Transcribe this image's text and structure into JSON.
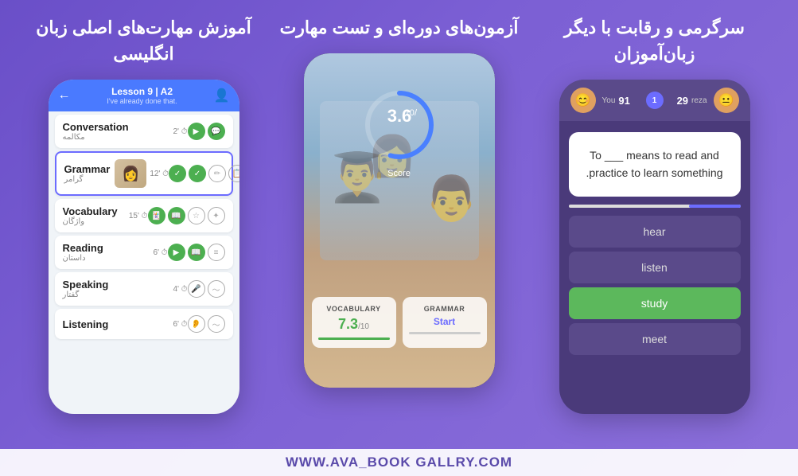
{
  "page": {
    "background": "#7b5fd4",
    "watermark": "WWW.AVA_BOOK GALLRY.COM"
  },
  "left_section": {
    "title": "سرگرمی و رقابت با\nدیگر زبان‌آموزان",
    "phone": {
      "you_label": "You",
      "you_score": "91",
      "vs_label": "1",
      "reza_score": "29",
      "reza_label": "reza",
      "question": "To ___ means to read and practice to learn something.",
      "answers": [
        {
          "text": "hear",
          "state": "normal"
        },
        {
          "text": "listen",
          "state": "normal"
        },
        {
          "text": "study",
          "state": "correct"
        },
        {
          "text": "meet",
          "state": "normal"
        }
      ]
    }
  },
  "mid_section": {
    "title": "آزمون‌های دوره‌ای و\nتست مهارت",
    "phone": {
      "score": "3.6",
      "score_denom": "/10",
      "score_label": "Score",
      "tab_vocabulary": {
        "title": "VOCABULARY",
        "score": "7.3",
        "denom": "/10"
      },
      "tab_grammar": {
        "title": "GRAMMAR",
        "action": "Start"
      }
    }
  },
  "right_section": {
    "title": "آموزش مهارت‌های\nاصلی زبان انگلیسی",
    "phone": {
      "lesson_title": "Lesson 9 | A2",
      "lesson_subtitle": "I've already done that.",
      "skills": [
        {
          "name": "Conversation",
          "name_fa": "مکالمه",
          "duration": "2'",
          "icons": [
            "play",
            "chat"
          ]
        },
        {
          "name": "Grammar",
          "name_fa": "گرامر",
          "duration": "12'",
          "highlighted": true,
          "icons": [
            "check",
            "check2",
            "edit",
            "copy",
            "list"
          ]
        },
        {
          "name": "Vocabulary",
          "name_fa": "واژگان",
          "duration": "15'",
          "icons": [
            "cards",
            "book",
            "list2",
            "stars"
          ]
        },
        {
          "name": "Reading",
          "name_fa": "داستان",
          "duration": "6'",
          "icons": [
            "play2",
            "book2",
            "lines"
          ]
        },
        {
          "name": "Speaking",
          "name_fa": "گفتار",
          "duration": "4'",
          "icons": [
            "mic",
            "wave"
          ]
        },
        {
          "name": "Listening",
          "name_fa": "",
          "duration": "6'",
          "icons": [
            "ear",
            "wave2"
          ]
        }
      ]
    }
  }
}
